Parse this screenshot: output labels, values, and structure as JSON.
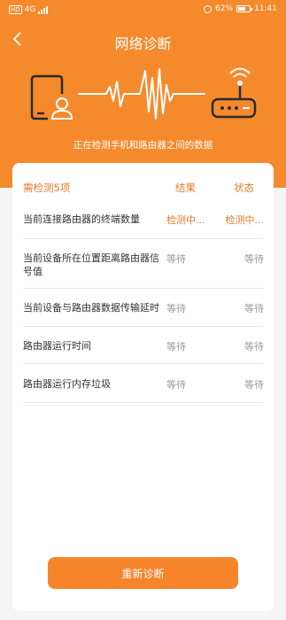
{
  "status_bar": {
    "hd": "HD",
    "network": "4G",
    "battery_text": "62%",
    "battery_level": 0.62,
    "time": "11:41"
  },
  "header": {
    "title": "网络诊断",
    "back_icon": "chevron-left-icon"
  },
  "banner": {
    "caption": "正在检测手机和路由器之间的数据",
    "left_icon": "phone-user-icon",
    "right_icon": "router-icon"
  },
  "table": {
    "header_name": "需检测5项",
    "header_result": "结果",
    "header_status": "状态",
    "rows": [
      {
        "name": "当前连接路由器的终端数量",
        "result": "检测中...",
        "status": "检测中..."
      },
      {
        "name": "当前设备所在位置距离路由器信号值",
        "result": "等待",
        "status": "等待"
      },
      {
        "name": "当前设备与路由器数据传输延时",
        "result": "等待",
        "status": "等待"
      },
      {
        "name": "路由器运行时间",
        "result": "等待",
        "status": "等待"
      },
      {
        "name": "路由器运行内存垃圾",
        "result": "等待",
        "status": "等待"
      }
    ]
  },
  "footer": {
    "rediagnose_label": "重新诊断"
  },
  "colors": {
    "accent": "#f58a2c",
    "accent_text": "#e07b2b",
    "muted": "#999999"
  }
}
